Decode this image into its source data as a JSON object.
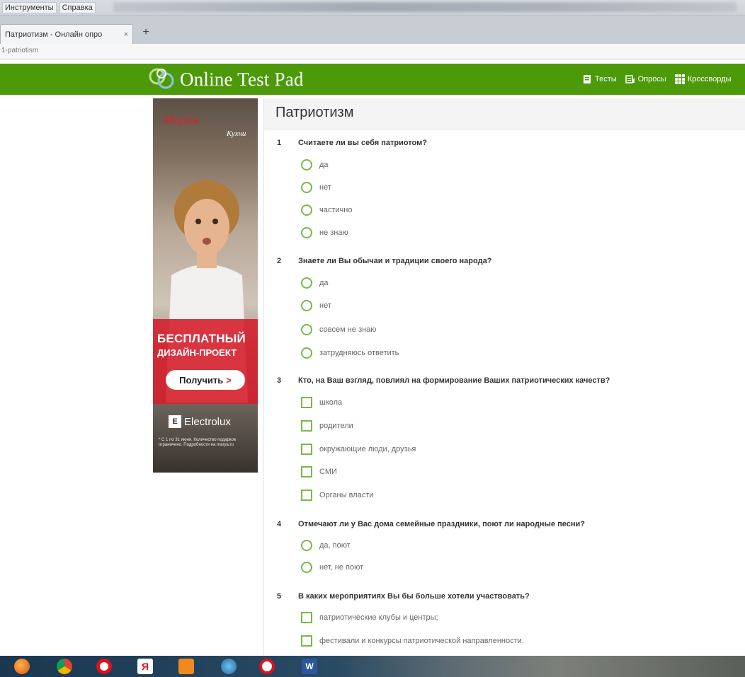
{
  "browser": {
    "menu": [
      "Инструменты",
      "Справка"
    ],
    "tab_title": "Патриотизм - Онлайн опро",
    "tab_close": "×",
    "new_tab": "+",
    "url": "1-patriotism"
  },
  "site": {
    "logo_text": "Online Test Pad",
    "nav": [
      {
        "label": "Тесты",
        "icon": "test-icon"
      },
      {
        "label": "Опросы",
        "icon": "survey-icon"
      },
      {
        "label": "Кроссворды",
        "icon": "crossword-icon"
      }
    ],
    "brand_color": "#4c9a0a"
  },
  "ad": {
    "brand": "Мария",
    "brand_sub": "Кухни",
    "headline": "БЕСПЛАТНЫЙ",
    "subheadline": "ДИЗАЙН-ПРОЕКТ",
    "button": "Получить",
    "button_arrow": ">",
    "sponsor": "Electrolux",
    "fine_print": "* С 1 по 31 июня. Количество подарков ограничено. Подробности на marya.ru"
  },
  "test": {
    "title": "Патриотизм",
    "questions": [
      {
        "number": "1",
        "text": "Считаете ли вы себя патриотом?",
        "type": "radio",
        "options": [
          "да",
          "нет",
          "частично",
          "не знаю"
        ]
      },
      {
        "number": "2",
        "text": "Знаете ли Вы обычаи и традиции своего народа?",
        "type": "radio",
        "options": [
          "да",
          "нет",
          "совсем не знаю",
          "затрудняюсь ответить"
        ]
      },
      {
        "number": "3",
        "text": "Кто, на Ваш взгляд, повлиял на формирование Ваших патриотических качеств?",
        "type": "checkbox",
        "options": [
          "школа",
          "родители",
          "окружающие люди, друзья",
          "СМИ",
          "Органы власти"
        ]
      },
      {
        "number": "4",
        "text": "Отмечают ли у Вас дома семейные праздники, поют ли народные песни?",
        "type": "radio",
        "options": [
          "да, поют",
          "нет, не поют"
        ]
      },
      {
        "number": "5",
        "text": "В каких мероприятиях Вы бы больше хотели участвовать?",
        "type": "checkbox",
        "options": [
          "патриотические клубы и центры;",
          "фестивали и конкурсы патриотической направленности."
        ]
      }
    ],
    "accent_color": "#79b84a"
  },
  "taskbar": {
    "apps": [
      "firefox-icon",
      "chrome-icon",
      "opera-icon",
      "yandex-icon",
      "store-icon",
      "explorer-icon",
      "yandex-browser-icon",
      "word-icon"
    ]
  }
}
